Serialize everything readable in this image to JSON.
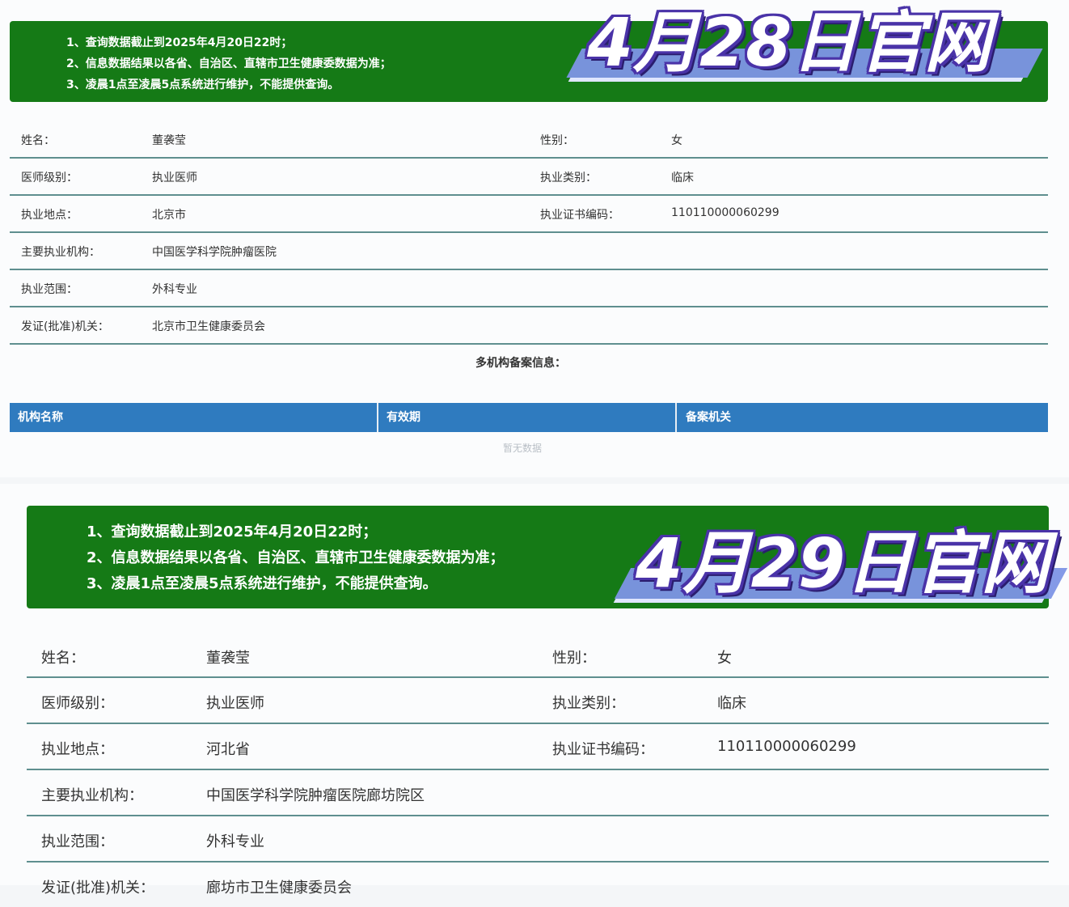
{
  "panels": [
    {
      "stamp": "4月28日官网",
      "notes": [
        "1、查询数据截止到2025年4月20日22时；",
        "2、信息数据结果以各省、自治区、直辖市卫生健康委数据为准；",
        "3、凌晨1点至凌晨5点系统进行维护，不能提供查询。"
      ],
      "rows": [
        {
          "l1": "姓名：",
          "v1": "董袭莹",
          "l2": "性别：",
          "v2": "女"
        },
        {
          "l1": "医师级别：",
          "v1": "执业医师",
          "l2": "执业类别：",
          "v2": "临床"
        },
        {
          "l1": "执业地点：",
          "v1": "北京市",
          "l2": "执业证书编码：",
          "v2": "110110000060299"
        },
        {
          "l1": "主要执业机构：",
          "v1": "中国医学科学院肿瘤医院",
          "l2": "",
          "v2": ""
        },
        {
          "l1": "执业范围：",
          "v1": "外科专业",
          "l2": "",
          "v2": ""
        },
        {
          "l1": "发证(批准)机关：",
          "v1": "北京市卫生健康委员会",
          "l2": "",
          "v2": ""
        }
      ],
      "multi_title": "多机构备案信息：",
      "table_headers": [
        "机构名称",
        "有效期",
        "备案机关"
      ],
      "empty_text": "暂无数据"
    },
    {
      "stamp": "4月29日官网",
      "notes": [
        "1、查询数据截止到2025年4月20日22时；",
        "2、信息数据结果以各省、自治区、直辖市卫生健康委数据为准；",
        "3、凌晨1点至凌晨5点系统进行维护，不能提供查询。"
      ],
      "rows": [
        {
          "l1": "姓名：",
          "v1": "董袭莹",
          "l2": "性别：",
          "v2": "女"
        },
        {
          "l1": "医师级别：",
          "v1": "执业医师",
          "l2": "执业类别：",
          "v2": "临床"
        },
        {
          "l1": "执业地点：",
          "v1": "河北省",
          "l2": "执业证书编码：",
          "v2": "110110000060299"
        },
        {
          "l1": "主要执业机构：",
          "v1": "中国医学科学院肿瘤医院廊坊院区",
          "l2": "",
          "v2": ""
        },
        {
          "l1": "执业范围：",
          "v1": "外科专业",
          "l2": "",
          "v2": ""
        },
        {
          "l1": "发证(批准)机关：",
          "v1": "廊坊市卫生健康委员会",
          "l2": "",
          "v2": ""
        }
      ]
    }
  ],
  "colors": {
    "banner": "#157a16",
    "table_header": "#2f7bbf",
    "row_line": "#5f8f8f",
    "stamp_outline": "#4a33a8"
  }
}
